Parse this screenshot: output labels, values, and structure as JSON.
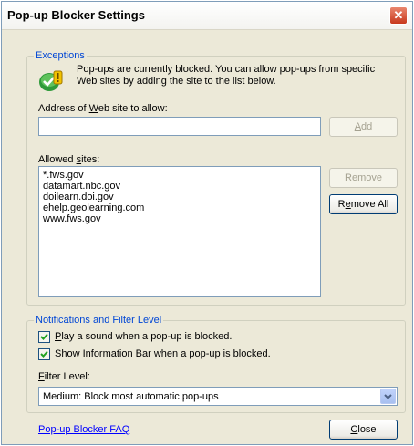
{
  "window": {
    "title": "Pop-up Blocker Settings",
    "close_glyph": "✕"
  },
  "exceptions": {
    "legend": "Exceptions",
    "info_line1": "Pop-ups are currently blocked.  You can allow pop-ups from specific",
    "info_line2": "Web sites by adding the site to the list below.",
    "address_label_pre": "Address of ",
    "address_label_key": "W",
    "address_label_post": "eb site to allow:",
    "address_value": "",
    "add_button_key": "A",
    "add_button_rest": "dd",
    "allowed_label_pre": "Allowed ",
    "allowed_label_key": "s",
    "allowed_label_post": "ites:",
    "allowed_sites": [
      "*.fws.gov",
      "datamart.nbc.gov",
      "doilearn.doi.gov",
      "ehelp.geolearning.com",
      "www.fws.gov"
    ],
    "remove_button_key": "R",
    "remove_button_rest": "emove",
    "remove_all_key": "e",
    "remove_all_pre": "R",
    "remove_all_post": "move All"
  },
  "notifications": {
    "legend": "Notifications and Filter Level",
    "play_sound_key": "P",
    "play_sound_rest": "lay a sound when a pop-up is blocked.",
    "play_sound_checked": true,
    "info_bar_pre": "Show ",
    "info_bar_key": "I",
    "info_bar_post": "nformation Bar when a pop-up is blocked.",
    "info_bar_checked": true,
    "filter_label_key": "F",
    "filter_label_rest": "ilter Level:",
    "filter_value": "Medium: Block most automatic pop-ups"
  },
  "footer": {
    "faq_link": "Pop-up Blocker FAQ",
    "close_key": "C",
    "close_rest": "lose"
  },
  "colors": {
    "accent": "#0046d5",
    "dialog_bg": "#ece9d8",
    "close_red": "#c8391d"
  }
}
